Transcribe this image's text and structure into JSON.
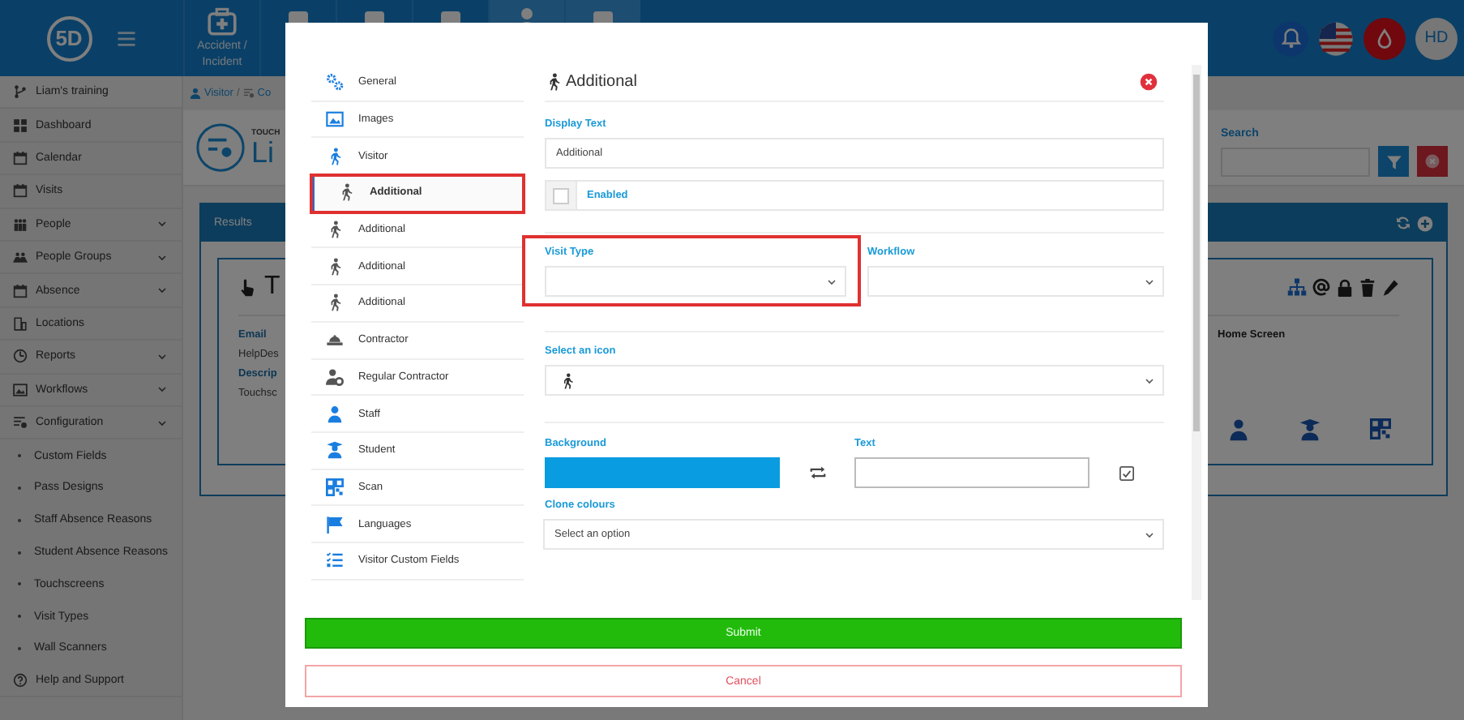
{
  "header": {
    "logo": "5D",
    "tiles": [
      {
        "label": "Accident / Incident"
      }
    ],
    "user_initials": "HD"
  },
  "sidebar": {
    "project": "Liam's training",
    "items": [
      {
        "label": "Dashboard",
        "expandable": false
      },
      {
        "label": "Calendar",
        "expandable": false
      },
      {
        "label": "Visits",
        "expandable": false
      },
      {
        "label": "People",
        "expandable": true
      },
      {
        "label": "People Groups",
        "expandable": true
      },
      {
        "label": "Absence",
        "expandable": true
      },
      {
        "label": "Locations",
        "expandable": false
      },
      {
        "label": "Reports",
        "expandable": true
      },
      {
        "label": "Workflows",
        "expandable": true
      },
      {
        "label": "Configuration",
        "expandable": true,
        "expanded": true,
        "children": [
          {
            "label": "Custom Fields"
          },
          {
            "label": "Pass Designs"
          },
          {
            "label": "Staff Absence Reasons"
          },
          {
            "label": "Student Absence Reasons"
          },
          {
            "label": "Touchscreens"
          },
          {
            "label": "Visit Types"
          },
          {
            "label": "Wall Scanners"
          }
        ]
      },
      {
        "label": "Help and Support",
        "expandable": false
      }
    ]
  },
  "page": {
    "breadcrumb": [
      "Visitor",
      "Co"
    ],
    "breadcrumb_separator": "/",
    "subtitle": "TOUCH",
    "title": "Li",
    "search": {
      "label": "Search"
    },
    "results": {
      "title": "Results",
      "card": {
        "title": "T",
        "fields": [
          {
            "label": "Email",
            "value": "HelpDes"
          },
          {
            "label": "Descrip",
            "value": "Touchsc"
          }
        ],
        "home_screen_label": "Home Screen"
      }
    }
  },
  "modal": {
    "title": "Additional",
    "nav": [
      {
        "label": "General",
        "selected": false,
        "highlighted": false
      },
      {
        "label": "Images",
        "selected": false,
        "highlighted": false
      },
      {
        "label": "Visitor",
        "selected": false,
        "highlighted": false
      },
      {
        "label": "Additional",
        "selected": true,
        "highlighted": true
      },
      {
        "label": "Additional",
        "selected": false,
        "highlighted": false
      },
      {
        "label": "Additional",
        "selected": false,
        "highlighted": false
      },
      {
        "label": "Additional",
        "selected": false,
        "highlighted": false
      },
      {
        "label": "Contractor",
        "selected": false,
        "highlighted": false
      },
      {
        "label": "Regular Contractor",
        "selected": false,
        "highlighted": false
      },
      {
        "label": "Staff",
        "selected": false,
        "highlighted": false
      },
      {
        "label": "Student",
        "selected": false,
        "highlighted": false
      },
      {
        "label": "Scan",
        "selected": false,
        "highlighted": false
      },
      {
        "label": "Languages",
        "selected": false,
        "highlighted": false
      },
      {
        "label": "Visitor Custom Fields",
        "selected": false,
        "highlighted": false
      }
    ],
    "form": {
      "display_text": {
        "label": "Display Text",
        "value": "Additional"
      },
      "enabled": {
        "label": "Enabled",
        "checked": false
      },
      "visit_type": {
        "label": "Visit Type",
        "highlighted": true
      },
      "workflow": {
        "label": "Workflow"
      },
      "icon_select": {
        "label": "Select an icon"
      },
      "background": {
        "label": "Background",
        "color": "#0a9ce0"
      },
      "text": {
        "label": "Text",
        "color": "#ffffff"
      },
      "clone": {
        "label": "Clone colours",
        "placeholder": "Select an option"
      }
    },
    "buttons": {
      "submit": "Submit",
      "cancel": "Cancel"
    }
  }
}
